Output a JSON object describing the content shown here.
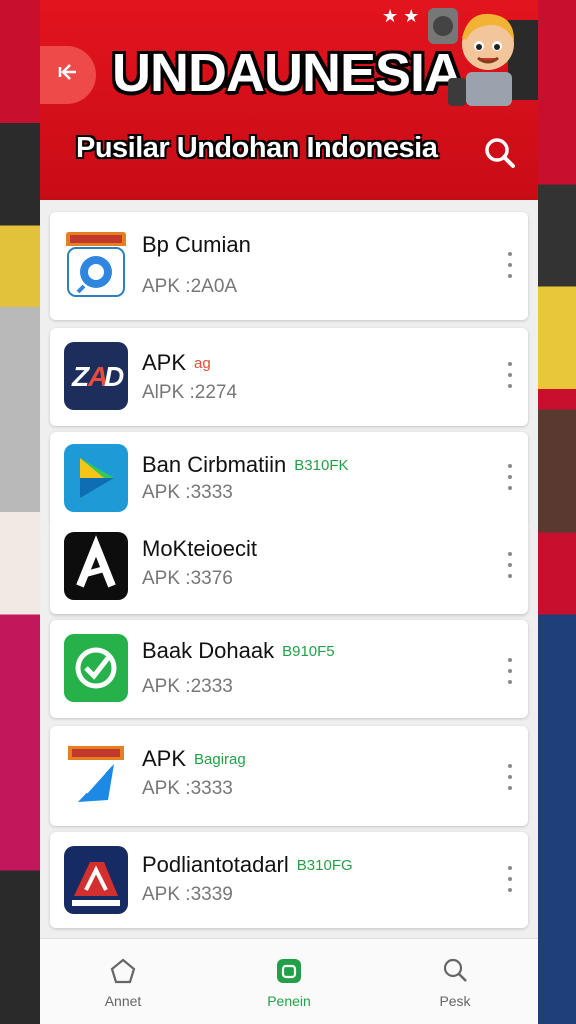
{
  "header": {
    "title": "UNDAUNESIA",
    "subtitle": "Pusilar Undohan Indonesia",
    "back_icon": "back-arrow-icon",
    "search_icon": "search-icon",
    "color": "#e3141e"
  },
  "apps": [
    {
      "name": "Bp Cumian",
      "badge": "",
      "sub": "APK :2A0A",
      "icon": "chrome-like-icon",
      "badge_color": ""
    },
    {
      "name": "APK",
      "badge": "ag",
      "sub": "AlPK :2274",
      "icon": "zap-icon",
      "badge_color": "#e74c3c"
    },
    {
      "name": "Ban Cirbmatiin",
      "badge": "B310FK",
      "sub": "APK :3333",
      "icon": "play-store-icon",
      "badge_color": "#23a047"
    },
    {
      "name": "MoKteioecit",
      "badge": "",
      "sub": "APK :3376",
      "icon": "a-logo-icon",
      "badge_color": ""
    },
    {
      "name": "Baak Dohaak",
      "badge": "B910F5",
      "sub": "APK :2333",
      "icon": "green-star-icon",
      "badge_color": "#23a047"
    },
    {
      "name": "APK",
      "badge": "Bagirag",
      "sub": "APK :3333",
      "icon": "kite-icon",
      "badge_color": "#23a047"
    },
    {
      "name": "Podliantotadarl",
      "badge": "B310FG",
      "sub": "APK :3339",
      "icon": "red-logo-icon",
      "badge_color": "#23a047"
    }
  ],
  "nav": [
    {
      "label": "Annet",
      "icon": "home-icon"
    },
    {
      "label": "Penein",
      "icon": "app-icon"
    },
    {
      "label": "Pesk",
      "icon": "search-icon"
    }
  ],
  "accent": "#23a047"
}
